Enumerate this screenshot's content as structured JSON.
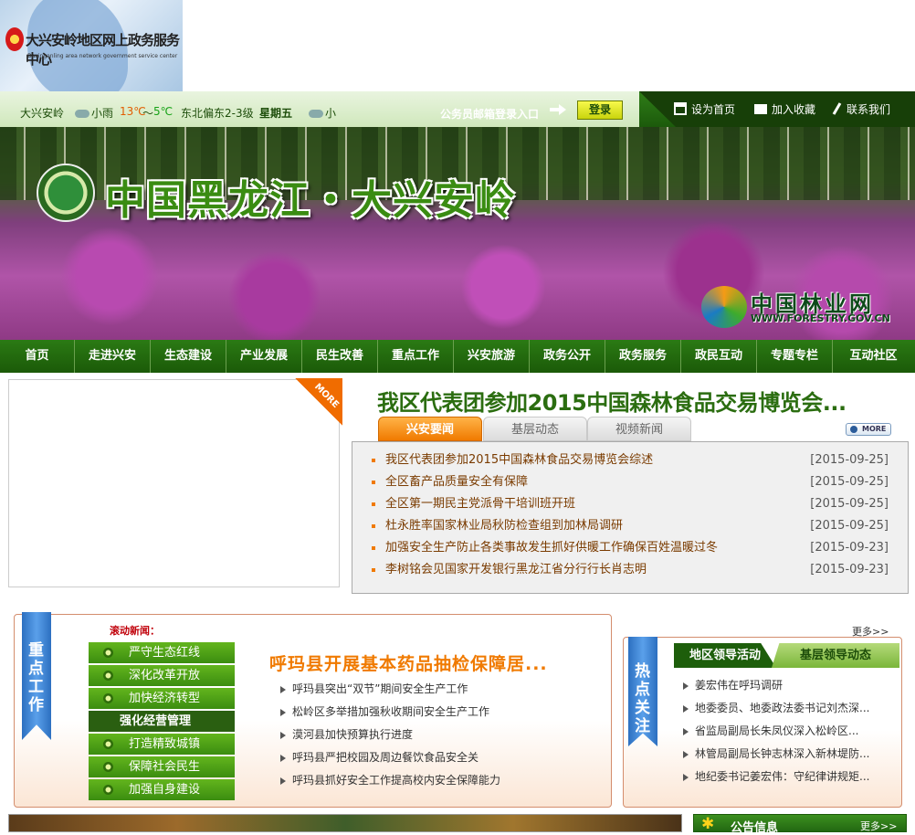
{
  "logo": {
    "title": "大兴安岭地区网上政务服务中心",
    "subtitle": "Daxinganling area network government service center"
  },
  "weather": {
    "city": "大兴安岭",
    "condition": "小雨",
    "temp_high": "13℃",
    "sep": "～",
    "temp_low": "5℃",
    "wind": "东北偏东2-3级",
    "weekday": "星期五",
    "next": "小"
  },
  "topbar": {
    "login_label": "公务员邮箱登录入口",
    "login_button": "登录",
    "set_home": "设为首页",
    "bookmark": "加入收藏",
    "contact": "联系我们"
  },
  "banner": {
    "title": "中国黑龙江・大兴安岭",
    "forestry_cn": "中国林业网",
    "forestry_en": "WWW.FORESTRY.GOV.CN"
  },
  "nav": [
    "首页",
    "走进兴安",
    "生态建设",
    "产业发展",
    "民生改善",
    "重点工作",
    "兴安旅游",
    "政务公开",
    "政务服务",
    "政民互动",
    "专题专栏",
    "互动社区"
  ],
  "feature": {
    "more_corner": "MORE",
    "headline": "我区代表团参加2015中国森林食品交易博览会...",
    "tabs": [
      "兴安要闻",
      "基层动态",
      "视频新闻"
    ],
    "more_button": "MORE",
    "news": [
      {
        "title": "我区代表团参加2015中国森林食品交易博览会综述",
        "date": "[2015-09-25]"
      },
      {
        "title": "全区畜产品质量安全有保障",
        "date": "[2015-09-25]"
      },
      {
        "title": "全区第一期民主党派骨干培训班开班",
        "date": "[2015-09-25]"
      },
      {
        "title": "杜永胜率国家林业局秋防检查组到加林局调研",
        "date": "[2015-09-25]"
      },
      {
        "title": "加强安全生产防止各类事故发生抓好供暖工作确保百姓温暖过冬",
        "date": "[2015-09-23]"
      },
      {
        "title": "李树铭会见国家开发银行黑龙江省分行行长肖志明",
        "date": "[2015-09-23]"
      }
    ]
  },
  "key_work": {
    "ribbon": "重点工作",
    "scroll_label": "滚动新闻：",
    "more": "更多>>",
    "pillars": [
      "严守生态红线",
      "深化改革开放",
      "加快经济转型",
      "强化经营管理",
      "打造精致城镇",
      "保障社会民生",
      "加强自身建设"
    ],
    "title": "呼玛县开展基本药品抽检保障居...",
    "items": [
      "呼玛县突出“双节”期间安全生产工作",
      "松岭区多举措加强秋收期间安全生产工作",
      "漠河县加快预算执行进度",
      "呼玛县严把校园及周边餐饮食品安全关",
      "呼玛县抓好安全工作提高校内安全保障能力"
    ]
  },
  "hot": {
    "ribbon": "热点关注",
    "tab_active": "地区领导活动",
    "tab_inactive": "基层领导动态",
    "items": [
      "姜宏伟在呼玛调研",
      "地委委员、地委政法委书记刘杰深...",
      "省监局副局长朱凤仪深入松岭区...",
      "林管局副局长钟志林深入新林堤防...",
      "地纪委书记姜宏伟：守纪律讲规矩..."
    ]
  },
  "notice": {
    "label": "公告信息",
    "more": "更多>>"
  }
}
